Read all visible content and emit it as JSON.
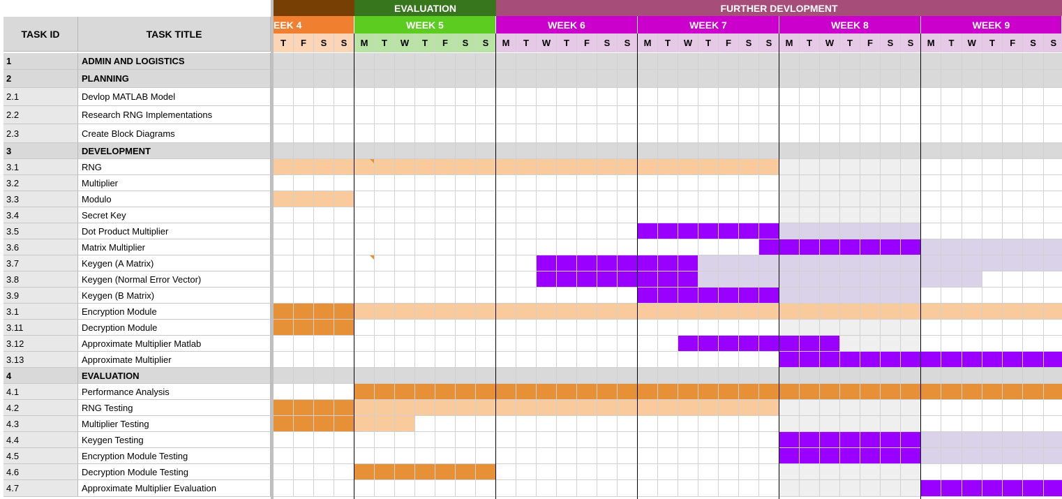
{
  "header": {
    "task_id_label": "TASK ID",
    "task_title_label": "TASK TITLE"
  },
  "phases": [
    {
      "label": "",
      "color": "#783f04"
    },
    {
      "label": "EVALUATION",
      "color": "#38761d"
    },
    {
      "label": "FURTHER DEVLOPMENT",
      "color": "#a64d79"
    }
  ],
  "weeks": [
    {
      "label": "EEK 4",
      "color": "#f08030",
      "daybg": "#fbd5b5",
      "days": [
        "T",
        "F",
        "S",
        "S"
      ]
    },
    {
      "label": "WEEK 5",
      "color": "#5ccc20",
      "daybg": "#b9e3a4",
      "days": [
        "M",
        "T",
        "W",
        "T",
        "F",
        "S",
        "S"
      ]
    },
    {
      "label": "WEEK 6",
      "color": "#cc00cc",
      "daybg": "#e6c9e6",
      "days": [
        "M",
        "T",
        "W",
        "T",
        "F",
        "S",
        "S"
      ]
    },
    {
      "label": "WEEK 7",
      "color": "#cc00cc",
      "daybg": "#e6c9e6",
      "days": [
        "M",
        "T",
        "W",
        "T",
        "F",
        "S",
        "S"
      ]
    },
    {
      "label": "WEEK 8",
      "color": "#cc00cc",
      "daybg": "#e6c9e6",
      "days": [
        "M",
        "T",
        "W",
        "T",
        "F",
        "S",
        "S"
      ]
    },
    {
      "label": "WEEK 9",
      "color": "#cc00cc",
      "daybg": "#e6c9e6",
      "days": [
        "M",
        "T",
        "W",
        "T",
        "F",
        "S",
        "S"
      ]
    }
  ],
  "colors": {
    "section": "#d9d9d9",
    "light_orange": "#f9cb9c",
    "dark_orange": "#e69138",
    "purple": "#9900ff",
    "light_purple": "#d9d2e9",
    "light_gray": "#efefef",
    "white": "#ffffff"
  },
  "tasks": [
    {
      "id": "1",
      "title": "ADMIN AND LOGISTICS",
      "section": true,
      "bars": []
    },
    {
      "id": "2",
      "title": "PLANNING",
      "section": true,
      "bars": []
    },
    {
      "id": "2.1",
      "title": "Devlop MATLAB Model",
      "section": false,
      "bars": []
    },
    {
      "id": "2.2",
      "title": "Research RNG Implementations",
      "section": false,
      "bars": []
    },
    {
      "id": "2.3",
      "title": "Create Block Diagrams",
      "section": false,
      "bars": []
    },
    {
      "id": "3",
      "title": "DEVELOPMENT",
      "section": true,
      "bars": []
    },
    {
      "id": "3.1",
      "title": "RNG",
      "section": false,
      "bars": [
        {
          "start": 0,
          "end": 25,
          "color": "light_orange"
        },
        {
          "start": 25,
          "end": 32,
          "color": "light_gray"
        }
      ]
    },
    {
      "id": "3.2",
      "title": "Multiplier",
      "section": false,
      "bars": [
        {
          "start": 25,
          "end": 32,
          "color": "light_gray"
        }
      ]
    },
    {
      "id": "3.3",
      "title": "Modulo",
      "section": false,
      "bars": [
        {
          "start": 0,
          "end": 4,
          "color": "light_orange"
        },
        {
          "start": 25,
          "end": 32,
          "color": "light_gray"
        }
      ]
    },
    {
      "id": "3.4",
      "title": "Secret Key",
      "section": false,
      "bars": [
        {
          "start": 25,
          "end": 32,
          "color": "light_gray"
        }
      ]
    },
    {
      "id": "3.5",
      "title": "Dot Product Multiplier",
      "section": false,
      "bars": [
        {
          "start": 18,
          "end": 25,
          "color": "purple"
        },
        {
          "start": 25,
          "end": 32,
          "color": "light_purple"
        }
      ]
    },
    {
      "id": "3.6",
      "title": "Matrix Multiplier",
      "section": false,
      "bars": [
        {
          "start": 24,
          "end": 32,
          "color": "purple"
        },
        {
          "start": 32,
          "end": 39,
          "color": "light_purple"
        }
      ]
    },
    {
      "id": "3.7",
      "title": "Keygen (A Matrix)",
      "section": false,
      "bars": [
        {
          "start": 13,
          "end": 21,
          "color": "purple"
        },
        {
          "start": 21,
          "end": 39,
          "color": "light_purple"
        }
      ]
    },
    {
      "id": "3.8",
      "title": "Keygen (Normal Error Vector)",
      "section": false,
      "bars": [
        {
          "start": 13,
          "end": 21,
          "color": "purple"
        },
        {
          "start": 21,
          "end": 35,
          "color": "light_purple"
        }
      ]
    },
    {
      "id": "3.9",
      "title": "Keygen (B Matrix)",
      "section": false,
      "bars": [
        {
          "start": 18,
          "end": 25,
          "color": "purple"
        },
        {
          "start": 25,
          "end": 32,
          "color": "light_purple"
        }
      ]
    },
    {
      "id": "3.1",
      "title": "Encryption Module",
      "section": false,
      "bars": [
        {
          "start": 0,
          "end": 4,
          "color": "dark_orange"
        },
        {
          "start": 4,
          "end": 39,
          "color": "light_orange"
        }
      ]
    },
    {
      "id": "3.11",
      "title": "Decryption Module",
      "section": false,
      "bars": [
        {
          "start": 0,
          "end": 4,
          "color": "dark_orange"
        },
        {
          "start": 25,
          "end": 32,
          "color": "light_gray"
        }
      ]
    },
    {
      "id": "3.12",
      "title": "Approximate Multiplier Matlab",
      "section": false,
      "bars": [
        {
          "start": 20,
          "end": 28,
          "color": "purple"
        },
        {
          "start": 28,
          "end": 32,
          "color": "light_gray"
        }
      ]
    },
    {
      "id": "3.13",
      "title": "Approximate Multiplier",
      "section": false,
      "bars": [
        {
          "start": 25,
          "end": 39,
          "color": "purple"
        }
      ]
    },
    {
      "id": "4",
      "title": "EVALUATION",
      "section": true,
      "bars": []
    },
    {
      "id": "4.1",
      "title": "Performance Analysis",
      "section": false,
      "bars": [
        {
          "start": 4,
          "end": 39,
          "color": "dark_orange"
        }
      ]
    },
    {
      "id": "4.2",
      "title": "RNG Testing",
      "section": false,
      "bars": [
        {
          "start": 0,
          "end": 4,
          "color": "dark_orange"
        },
        {
          "start": 4,
          "end": 25,
          "color": "light_orange"
        },
        {
          "start": 25,
          "end": 32,
          "color": "light_gray"
        }
      ]
    },
    {
      "id": "4.3",
      "title": "Multiplier Testing",
      "section": false,
      "bars": [
        {
          "start": 0,
          "end": 4,
          "color": "dark_orange"
        },
        {
          "start": 4,
          "end": 7,
          "color": "light_orange"
        },
        {
          "start": 25,
          "end": 32,
          "color": "light_gray"
        }
      ]
    },
    {
      "id": "4.4",
      "title": "Keygen Testing",
      "section": false,
      "bars": [
        {
          "start": 25,
          "end": 32,
          "color": "purple"
        },
        {
          "start": 32,
          "end": 39,
          "color": "light_purple"
        }
      ]
    },
    {
      "id": "4.5",
      "title": "Encryption Module Testing",
      "section": false,
      "bars": [
        {
          "start": 25,
          "end": 32,
          "color": "purple"
        },
        {
          "start": 32,
          "end": 39,
          "color": "light_purple"
        }
      ]
    },
    {
      "id": "4.6",
      "title": "Decryption Module Testing",
      "section": false,
      "bars": [
        {
          "start": 4,
          "end": 11,
          "color": "dark_orange"
        },
        {
          "start": 25,
          "end": 32,
          "color": "light_gray"
        }
      ]
    },
    {
      "id": "4.7",
      "title": "Approximate Multiplier Evaluation",
      "section": false,
      "bars": [
        {
          "start": 25,
          "end": 32,
          "color": "light_gray"
        },
        {
          "start": 32,
          "end": 39,
          "color": "purple"
        }
      ]
    }
  ]
}
